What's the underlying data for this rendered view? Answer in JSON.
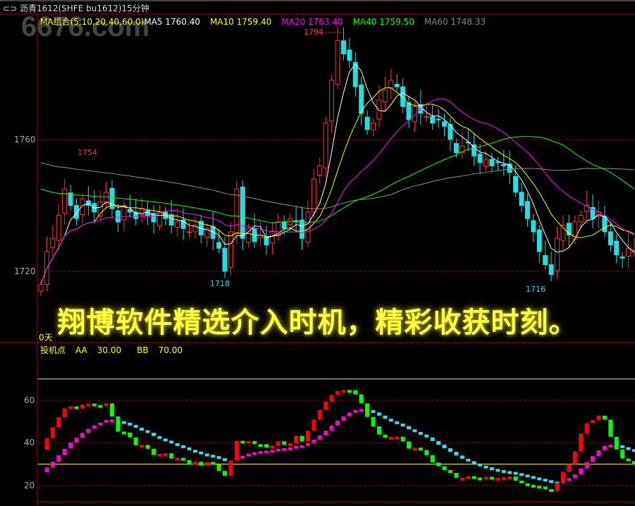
{
  "window": {
    "title": "沥青1612(SHFE bu1612)15分钟",
    "link_icon": "link-icon",
    "watermark": "6676.com"
  },
  "legend": {
    "group": "MA组合(5,10,20,40,60,0)",
    "ma5": "MA5 1760.40",
    "ma10": "MA10 1759.40",
    "ma20": "MA20 1763.40",
    "ma40": "MA40 1759.50",
    "ma60": "MA60 1748.33"
  },
  "annotations": {
    "high1": "1754",
    "low1": "1718",
    "peak": "1794",
    "low2": "1716",
    "days": "0天"
  },
  "caption": "翔博软件精选介入时机，精彩收获时刻。",
  "indicator": {
    "name": "投机点",
    "aa": "AA",
    "aa_val": "30.00",
    "bb": "BB",
    "bb_val": "70.00",
    "ticks": [
      "60",
      "40",
      "20"
    ]
  },
  "colors": {
    "up": "#ff3030",
    "down": "#20e0e0",
    "ma5": "#ffffff",
    "ma10": "#ffff00",
    "ma20": "#ff00ff",
    "ma40": "#00ff00",
    "ma60": "#909090",
    "axis": "#b00000"
  },
  "chart_data": {
    "type": "candlestick",
    "title": "沥青1612(SHFE bu1612)15分钟",
    "y_ticks": [
      "1760",
      "1720"
    ],
    "ylim": [
      1703,
      1800
    ],
    "closes": [
      1716,
      1726,
      1730,
      1737,
      1745,
      1740,
      1736,
      1742,
      1740,
      1738,
      1741,
      1744,
      1739,
      1735,
      1740,
      1738,
      1736,
      1739,
      1737,
      1735,
      1738,
      1736,
      1734,
      1735,
      1733,
      1732,
      1734,
      1731,
      1733,
      1730,
      1727,
      1720,
      1732,
      1745,
      1730,
      1733,
      1729,
      1731,
      1728,
      1732,
      1735,
      1733,
      1736,
      1735,
      1730,
      1738,
      1748,
      1752,
      1765,
      1778,
      1790,
      1786,
      1784,
      1776,
      1768,
      1763,
      1765,
      1772,
      1775,
      1778,
      1776,
      1770,
      1766,
      1770,
      1768,
      1767,
      1765,
      1766,
      1764,
      1760,
      1756,
      1758,
      1759,
      1755,
      1753,
      1754,
      1752,
      1753,
      1752,
      1750,
      1744,
      1740,
      1736,
      1732,
      1726,
      1722,
      1719,
      1730,
      1734,
      1731,
      1735,
      1737,
      1740,
      1736,
      1738,
      1732,
      1728,
      1725,
      1724,
      1727,
      1726
    ],
    "ma_periods": [
      5,
      10,
      20,
      40,
      60
    ],
    "indicator_ylim": [
      10,
      80
    ],
    "indicator_lines": [
      30,
      70
    ]
  }
}
